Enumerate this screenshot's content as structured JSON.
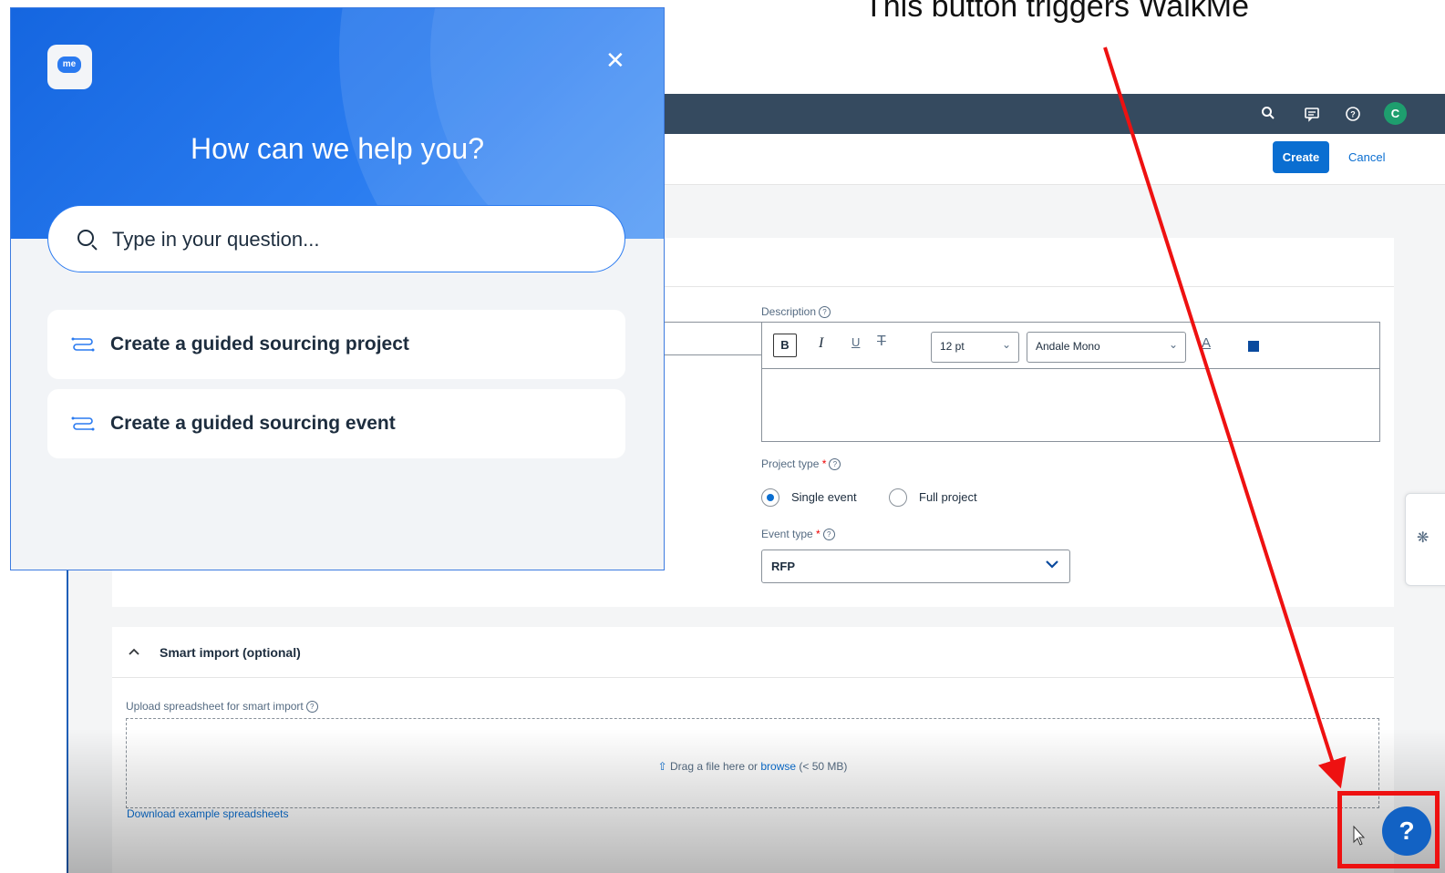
{
  "annotation": {
    "title": "This button triggers WalkMe",
    "highlight_color": "#ee1111"
  },
  "shellbar": {
    "icons": [
      "search-icon",
      "notification-icon",
      "help-icon"
    ],
    "avatar_initial": "C"
  },
  "toolbar": {
    "create_label": "Create",
    "cancel_label": "Cancel"
  },
  "form": {
    "description_label": "Description",
    "editor": {
      "bold": "B",
      "italic": "I",
      "underline": "U",
      "strike": "T",
      "font_size": "12 pt",
      "font_family": "Andale Mono",
      "text_color": "A"
    },
    "project_type_label": "Project type",
    "project_type_options": [
      "Single event",
      "Full project"
    ],
    "project_type_selected": "Single event",
    "event_type_label": "Event type",
    "event_type_value": "RFP",
    "required_mark": "*"
  },
  "smart_import": {
    "title": "Smart import (optional)",
    "upload_label": "Upload spreadsheet for smart import",
    "drop_text": "Drag a file here or ",
    "browse_link": "browse",
    "size_limit": "(< 50 MB)",
    "download_link": "Download example spreadsheets"
  },
  "walkme": {
    "logo_text": "me",
    "title": "How can we help you?",
    "search_placeholder": "Type in your question...",
    "items": [
      {
        "label": "Create a guided sourcing project"
      },
      {
        "label": "Create a guided sourcing event"
      }
    ],
    "brand_color": "#2a7af0"
  },
  "help_button": {
    "label": "?"
  },
  "colors": {
    "shellbar": "#354a5f",
    "primary": "#0a6ed1"
  }
}
